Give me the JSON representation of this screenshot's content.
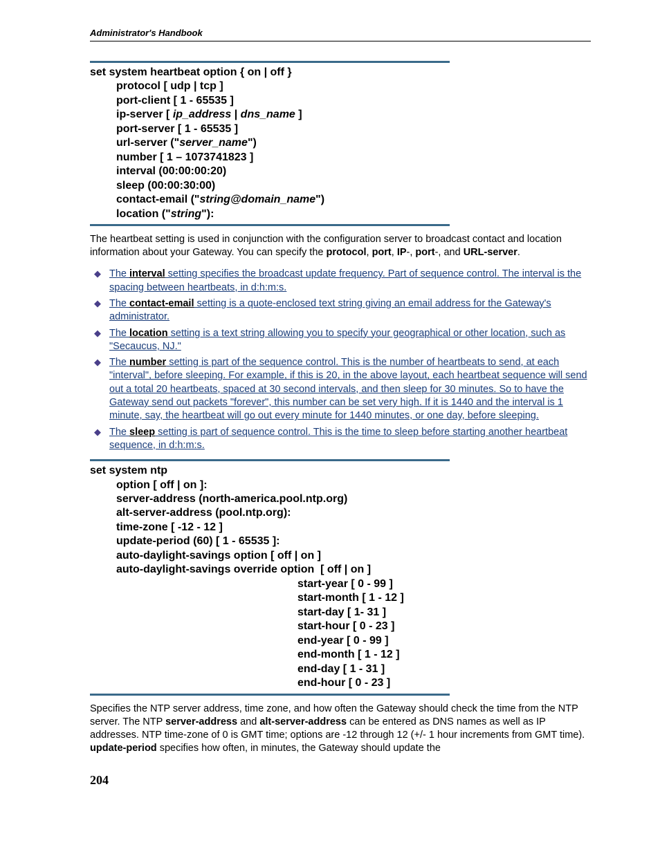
{
  "header": "Administrator's Handbook",
  "cmd1": {
    "l0": "set system heartbeat option { on | off }",
    "l1a": "protocol [ udp | tcp ]",
    "l2a": "port-client [ 1 - 65535 ]",
    "l3a": "ip-server [ ",
    "l3b": "ip_address",
    "l3c": " | ",
    "l3d": "dns_name",
    "l3e": " ]",
    "l4a": "port-server [ 1 - 65535 ]",
    "l5a": "url-server (\"",
    "l5b": "server_name",
    "l5c": "\")",
    "l6a": "number [ 1 – 1073741823 ]",
    "l7a": "interval (00:00:00:20)",
    "l8a": "sleep (00:00:30:00)",
    "l9a": "contact-email (\"",
    "l9b": "string@domain_name",
    "l9c": "\")",
    "l10a": "location (\"",
    "l10b": "string",
    "l10c": "\"):"
  },
  "p1": {
    "t1": "The heartbeat setting is used in conjunction with the configuration server to broadcast contact and location information about your Gateway. You can specify the ",
    "b1": "protocol",
    "t2": ", ",
    "b2": "port",
    "t3": ", ",
    "b3": "IP",
    "t4": "-, ",
    "b4": "port",
    "t5": "-, and ",
    "b5": "URL-server",
    "t6": "."
  },
  "bullets": [
    {
      "pre": "The ",
      "label": "interval",
      "post": " setting specifies the broadcast update frequency. Part of sequence control. The interval is the spacing between heartbeats, in d:h:m:s."
    },
    {
      "pre": "The ",
      "label": "contact-email",
      "post": " setting is a quote-enclosed text string giving an email address for the Gateway's administrator."
    },
    {
      "pre": "The ",
      "label": "location",
      "post": " setting is a text string allowing you to specify your geographical or other location, such as \"Secaucus, NJ.\""
    },
    {
      "pre": " The ",
      "label": "number",
      "post": " setting is part of the sequence control. This is the number of heartbeats to send, at each \"interval\", before sleeping. For example, if this is 20, in the above layout, each heartbeat sequence will send out a total 20 heartbeats, spaced at 30 second intervals, and then sleep for 30 minutes. So to have the Gateway send out packets \"forever\", this number can be set very high. If it is 1440 and the interval is 1 minute, say, the heartbeat will go out every minute for 1440 minutes, or one day, before sleeping."
    },
    {
      "pre": "The ",
      "label": "sleep",
      "post": " setting is part of sequence control. This is the time to sleep before starting another heartbeat sequence, in d:h:m:s."
    }
  ],
  "cmd2": {
    "l0": "set system ntp",
    "l1": "option [ off | on ]:",
    "l2": "server-address (north-america.pool.ntp.org)",
    "l3": "alt-server-address (pool.ntp.org):",
    "l4": "time-zone [ -12 - 12 ]",
    "l5": "update-period (60) [ 1 - 65535 ]:",
    "l6": "auto-daylight-savings option [ off | on ]",
    "l7": "auto-daylight-savings override option  [ off | on ]",
    "l8": "start-year [ 0 - 99 ]",
    "l9": "start-month [ 1 - 12 ]",
    "l10": "start-day [ 1- 31 ]",
    "l11": "start-hour [ 0 - 23 ]",
    "l12": "end-year [ 0 - 99 ]",
    "l13": "end-month [ 1 - 12 ]",
    "l14": "end-day [ 1 - 31 ]",
    "l15": "end-hour [ 0 - 23 ]"
  },
  "p2": {
    "t1": "Specifies the NTP server address, time zone, and how often the Gateway should check the time from the NTP server. The NTP ",
    "b1": "server-address",
    "t2": " and ",
    "b2": "alt-server-address",
    "t3": " can be entered as DNS names as well as IP addresses. NTP time-zone of 0 is GMT time; options are -12 through 12 (+/- 1 hour increments from GMT time). ",
    "b3": "update-period",
    "t4": " specifies how often, in minutes, the Gateway should update the"
  },
  "pagenum": "204"
}
